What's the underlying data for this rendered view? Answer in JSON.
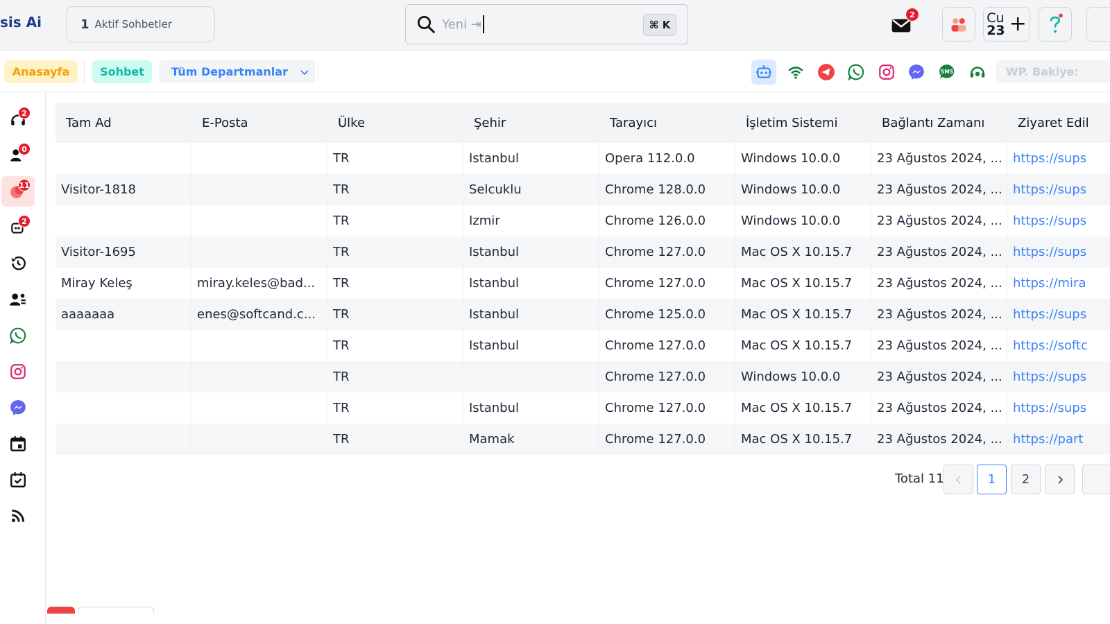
{
  "brand": {
    "name": "sis Ai"
  },
  "active_chats": {
    "count": "1",
    "label": "Aktif Sohbetler"
  },
  "search": {
    "placeholder": "Yeni ⇥",
    "shortcut": "⌘ K"
  },
  "header": {
    "mail_badge": "2",
    "user_initials": "Cu",
    "user_number": "23",
    "add_symbol": "+"
  },
  "subbar": {
    "home": "Anasayfa",
    "chat": "Sohbet",
    "departments": "Tüm Departmanlar",
    "balance": "WP. Bakiye:"
  },
  "channels": [
    "bot-icon",
    "wifi-icon",
    "telegram-icon",
    "whatsapp-icon",
    "instagram-icon",
    "messenger-icon",
    "sms-icon",
    "agent-icon"
  ],
  "sidenav": {
    "items": [
      {
        "icon": "live-visitors-icon",
        "badge": "2"
      },
      {
        "icon": "users-icon",
        "badge": "0"
      },
      {
        "icon": "active-chat-icon",
        "badge": "11"
      },
      {
        "icon": "bot-chat-icon",
        "badge": "2"
      },
      {
        "icon": "history-icon",
        "badge": ""
      },
      {
        "icon": "team-icon",
        "badge": ""
      },
      {
        "icon": "whatsapp-icon",
        "badge": ""
      },
      {
        "icon": "instagram-icon",
        "badge": ""
      },
      {
        "icon": "messenger-icon",
        "badge": ""
      },
      {
        "icon": "calendar-icon",
        "badge": ""
      },
      {
        "icon": "tasks-icon",
        "badge": ""
      },
      {
        "icon": "rss-icon",
        "badge": ""
      }
    ]
  },
  "table": {
    "columns": [
      "Tam Ad",
      "E-Posta",
      "Ülke",
      "Şehir",
      "Tarayıcı",
      "İşletim Sistemi",
      "Bağlantı Zamanı",
      "Ziyaret Edil"
    ],
    "rows": [
      [
        "",
        "",
        "TR",
        "Istanbul",
        "Opera 112.0.0",
        "Windows 10.0.0",
        "23 Ağustos 2024, ...",
        "https://sups"
      ],
      [
        "Visitor-1818",
        "",
        "TR",
        "Selcuklu",
        "Chrome 128.0.0",
        "Windows 10.0.0",
        "23 Ağustos 2024, ...",
        "https://sups"
      ],
      [
        "",
        "",
        "TR",
        "Izmir",
        "Chrome 126.0.0",
        "Windows 10.0.0",
        "23 Ağustos 2024, ...",
        "https://sups"
      ],
      [
        "Visitor-1695",
        "",
        "TR",
        "Istanbul",
        "Chrome 127.0.0",
        "Mac OS X 10.15.7",
        "23 Ağustos 2024, ...",
        "https://sups"
      ],
      [
        "Miray Keleş",
        "miray.keles@bad...",
        "TR",
        "Istanbul",
        "Chrome 127.0.0",
        "Mac OS X 10.15.7",
        "23 Ağustos 2024, ...",
        "https://mira"
      ],
      [
        "aaaaaaa",
        "enes@softcand.c...",
        "TR",
        "Istanbul",
        "Chrome 125.0.0",
        "Mac OS X 10.15.7",
        "23 Ağustos 2024, ...",
        "https://sups"
      ],
      [
        "",
        "",
        "TR",
        "Istanbul",
        "Chrome 127.0.0",
        "Mac OS X 10.15.7",
        "23 Ağustos 2024, ...",
        "https://softc"
      ],
      [
        "",
        "",
        "TR",
        "",
        "Chrome 127.0.0",
        "Windows 10.0.0",
        "23 Ağustos 2024, ...",
        "https://sups"
      ],
      [
        "",
        "",
        "TR",
        "Istanbul",
        "Chrome 127.0.0",
        "Mac OS X 10.15.7",
        "23 Ağustos 2024, ...",
        "https://sups"
      ],
      [
        "",
        "",
        "TR",
        "Mamak",
        "Chrome 127.0.0",
        "Mac OS X 10.15.7",
        "23 Ağustos 2024, ...",
        "https://part"
      ]
    ]
  },
  "pagination": {
    "total_label": "Total 11",
    "pages": [
      "1",
      "2"
    ],
    "current": "1"
  },
  "colors": {
    "accent": "#3b82f6",
    "badge": "#e11d2e",
    "home_pill": "#fef3c7",
    "chat_pill": "#ccfbf1"
  }
}
